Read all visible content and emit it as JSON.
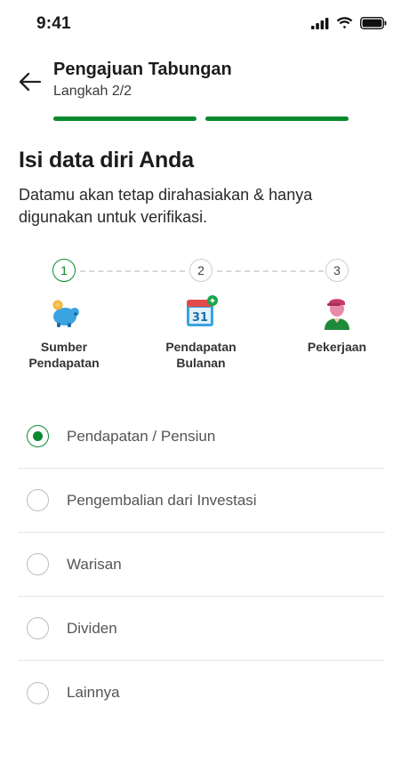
{
  "status_bar": {
    "time": "9:41"
  },
  "header": {
    "title": "Pengajuan Tabungan",
    "step_text": "Langkah 2/2",
    "progress": {
      "segments_total": 2,
      "segments_filled": 2
    },
    "accent_color": "#0a8a2e"
  },
  "page": {
    "heading": "Isi data diri Anda",
    "description": "Datamu akan tetap dirahasiakan & hanya digunakan untuk verifikasi."
  },
  "stepper": {
    "steps": [
      {
        "number": "1",
        "label": "Sumber\nPendapatan",
        "icon": "piggy-bank-icon",
        "active": true
      },
      {
        "number": "2",
        "label": "Pendapatan\nBulanan",
        "icon": "calendar-icon",
        "active": false,
        "calendar_day": "31"
      },
      {
        "number": "3",
        "label": "Pekerjaan",
        "icon": "person-icon",
        "active": false
      }
    ]
  },
  "options": [
    {
      "label": "Pendapatan / Pensiun",
      "selected": true
    },
    {
      "label": "Pengembalian dari Investasi",
      "selected": false
    },
    {
      "label": "Warisan",
      "selected": false
    },
    {
      "label": "Dividen",
      "selected": false
    },
    {
      "label": "Lainnya",
      "selected": false
    }
  ]
}
